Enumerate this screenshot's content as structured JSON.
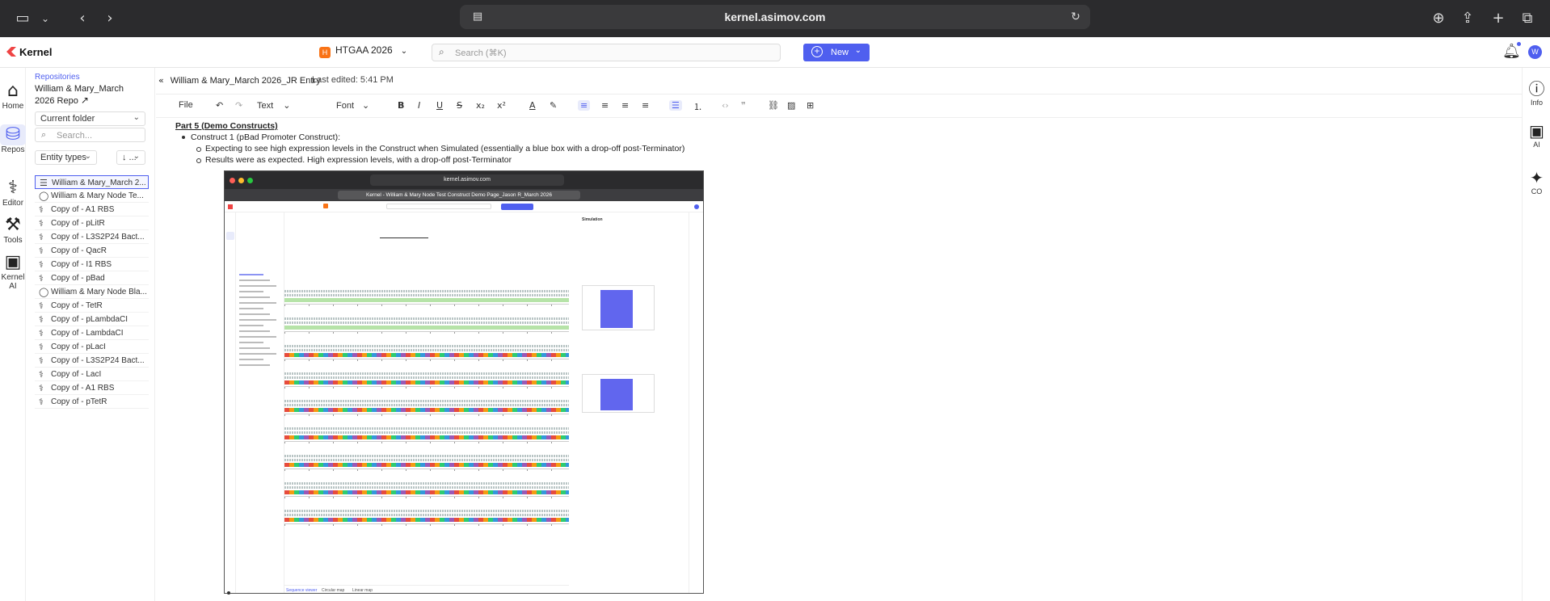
{
  "browser": {
    "url": "kernel.asimov.com"
  },
  "header": {
    "logo": "Kernel",
    "workspace_badge": "H",
    "workspace": "HTGAA 2026",
    "search_placeholder": "Search (⌘K)",
    "new_label": "New",
    "avatar": "W"
  },
  "left_rail": [
    {
      "label": "Home",
      "icon": "home-icon"
    },
    {
      "label": "Repos",
      "icon": "database-icon"
    },
    {
      "label": "Editor",
      "icon": "dna-icon"
    },
    {
      "label": "Tools",
      "icon": "tools-icon"
    },
    {
      "label": "Kernel AI",
      "icon": "chip-icon"
    }
  ],
  "sidebar": {
    "crumb": "Repositories",
    "repo_name": "William & Mary_March 2026 Repo",
    "folder_select": "Current folder",
    "search_placeholder": "Search...",
    "entity_select": "Entity types",
    "sort_select": "↓ ...",
    "files": [
      {
        "label": "William & Mary_March 2...",
        "icon": "doc-icon",
        "selected": true
      },
      {
        "label": "William & Mary Node Te...",
        "icon": "circle-icon"
      },
      {
        "label": "Copy of - A1 RBS",
        "icon": "dna-icon"
      },
      {
        "label": "Copy of - pLitR",
        "icon": "dna-icon"
      },
      {
        "label": "Copy of - L3S2P24 Bact...",
        "icon": "dna-icon"
      },
      {
        "label": "Copy of - QacR",
        "icon": "dna-icon"
      },
      {
        "label": "Copy of - I1 RBS",
        "icon": "dna-icon"
      },
      {
        "label": "Copy of - pBad",
        "icon": "dna-icon"
      },
      {
        "label": "William & Mary Node Bla...",
        "icon": "circle-icon"
      },
      {
        "label": "Copy of - TetR",
        "icon": "dna-icon"
      },
      {
        "label": "Copy of - pLambdaCI",
        "icon": "dna-icon"
      },
      {
        "label": "Copy of - LambdaCI",
        "icon": "dna-icon"
      },
      {
        "label": "Copy of - pLacI",
        "icon": "dna-icon"
      },
      {
        "label": "Copy of - L3S2P24 Bact...",
        "icon": "dna-icon"
      },
      {
        "label": "Copy of - LacI",
        "icon": "dna-icon"
      },
      {
        "label": "Copy of - A1 RBS",
        "icon": "dna-icon"
      },
      {
        "label": "Copy of - pTetR",
        "icon": "dna-icon"
      }
    ]
  },
  "document": {
    "title": "William & Mary_March 2026_JR Entry",
    "edited": "Last edited: 5:41 PM",
    "toolbar": {
      "file": "File",
      "text": "Text",
      "font": "Font"
    },
    "heading": "Part 5 (Demo Constructs)",
    "bullet1": "Construct 1 (pBad Promoter Construct):",
    "sub1": "Expecting to see high expression levels in the Construct when Simulated (essentially a blue box with a drop-off post-Terminator)",
    "sub2": "Results were as expected. High expression levels, with a drop-off post-Terminator"
  },
  "embedded": {
    "url": "kernel.asimov.com",
    "tab": "Kernel - William & Mary Node Test Construct Demo Page_Jason R_March 2026",
    "panel_title": "Simulation",
    "status_tabs": [
      "Sequence viewer",
      "Circular map",
      "Linear map"
    ],
    "bar_heights": [
      0.95,
      0.92
    ]
  },
  "right_rail": [
    {
      "label": "Info",
      "icon": "info-icon"
    },
    {
      "label": "AI",
      "icon": "chip-icon"
    },
    {
      "label": "CO",
      "icon": "sparkle-icon"
    }
  ]
}
